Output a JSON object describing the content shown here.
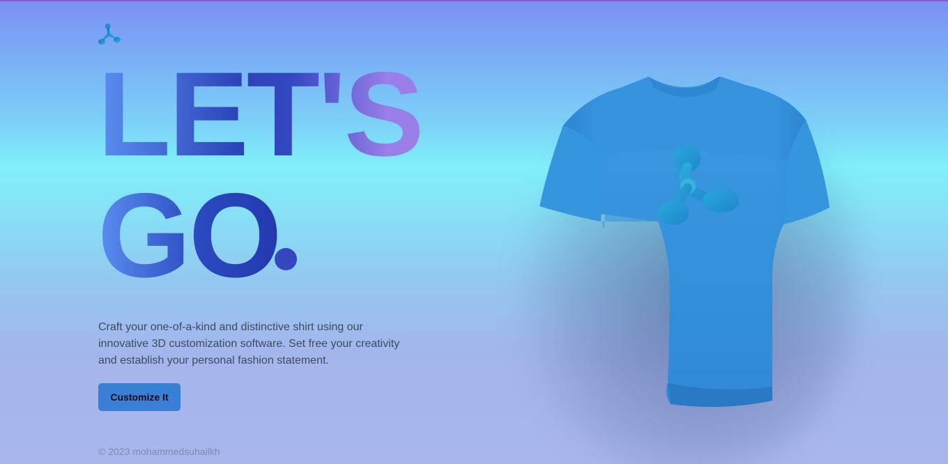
{
  "brand": {
    "logo_icon": "threejs-blob-logo-icon",
    "accent": "#3a7fd6"
  },
  "hero": {
    "headline_line1": "LET'S",
    "headline_line2": "GO",
    "description": "Craft your one-of-a-kind and distinctive shirt using our innovative 3D customization software. Set free your creativity and establish your personal fashion statement.",
    "cta_label": "Customize It"
  },
  "preview": {
    "item": "t-shirt",
    "shirt_color": "#3a96de",
    "decal_icon": "threejs-blob-logo-icon"
  },
  "footer": {
    "text": "© 2023 mohammedsuhailkh"
  }
}
